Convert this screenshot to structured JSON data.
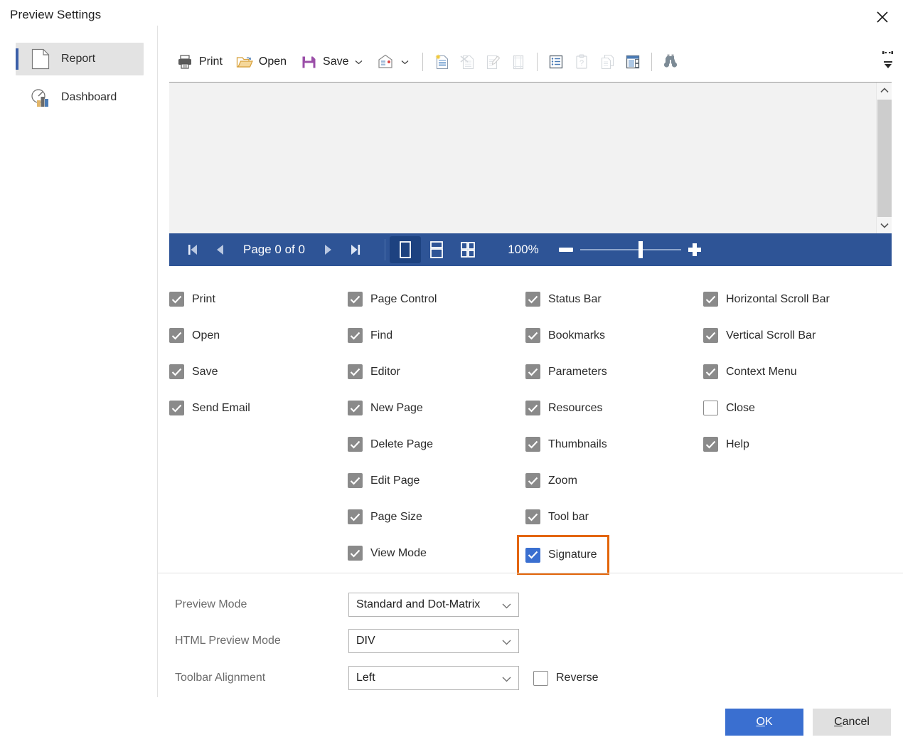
{
  "dialog": {
    "title": "Preview Settings",
    "close_icon": "close-icon"
  },
  "sidebar": {
    "items": [
      {
        "label": "Report",
        "icon": "document-page-icon",
        "selected": true
      },
      {
        "label": "Dashboard",
        "icon": "dashboard-chart-icon",
        "selected": false
      }
    ]
  },
  "toolbar": {
    "buttons": [
      {
        "label": "Print",
        "icon": "printer-icon",
        "caret": false,
        "enabled": true
      },
      {
        "label": "Open",
        "icon": "open-folder-icon",
        "caret": false,
        "enabled": true
      },
      {
        "label": "Save",
        "icon": "floppy-save-icon",
        "caret": true,
        "enabled": true
      },
      {
        "label": "",
        "icon": "send-email-icon",
        "caret": true,
        "enabled": true
      }
    ],
    "icon_buttons": [
      {
        "icon": "new-page-icon",
        "enabled": true
      },
      {
        "icon": "delete-page-icon",
        "enabled": false
      },
      {
        "icon": "edit-page-icon",
        "enabled": false
      },
      {
        "icon": "page-size-icon",
        "enabled": false
      },
      {
        "icon": "bookmarks-icon",
        "enabled": true
      },
      {
        "icon": "parameters-icon",
        "enabled": false
      },
      {
        "icon": "resources-icon",
        "enabled": false
      },
      {
        "icon": "thumbnails-icon",
        "enabled": true
      },
      {
        "icon": "find-binoculars-icon",
        "enabled": true
      }
    ],
    "overflow_icon": "toolbar-overflow-icon"
  },
  "navbar": {
    "first_icon": "first-page-icon",
    "prev_icon": "prev-page-icon",
    "page_label": "Page 0 of 0",
    "next_icon": "next-page-icon",
    "last_icon": "last-page-icon",
    "view_modes": [
      {
        "icon": "single-page-view-icon",
        "active": true
      },
      {
        "icon": "continuous-view-icon",
        "active": false
      },
      {
        "icon": "multi-page-view-icon",
        "active": false
      }
    ],
    "zoom_value": "100%",
    "zoom_minus_icon": "zoom-out-icon",
    "zoom_plus_icon": "zoom-in-icon",
    "zoom_slider_percent": 58,
    "accent_color": "#2e5496"
  },
  "scrollbar": {
    "up_icon": "scroll-up-icon",
    "down_icon": "scroll-down-icon"
  },
  "options": {
    "columns": [
      [
        {
          "label": "Print",
          "checked": true
        },
        {
          "label": "Open",
          "checked": true
        },
        {
          "label": "Save",
          "checked": true
        },
        {
          "label": "Send Email",
          "checked": true
        }
      ],
      [
        {
          "label": "Page Control",
          "checked": true
        },
        {
          "label": "Find",
          "checked": true
        },
        {
          "label": "Editor",
          "checked": true
        },
        {
          "label": "New Page",
          "checked": true
        },
        {
          "label": "Delete Page",
          "checked": true
        },
        {
          "label": "Edit Page",
          "checked": true
        },
        {
          "label": "Page Size",
          "checked": true
        },
        {
          "label": "View Mode",
          "checked": true
        }
      ],
      [
        {
          "label": "Status Bar",
          "checked": true
        },
        {
          "label": "Bookmarks",
          "checked": true
        },
        {
          "label": "Parameters",
          "checked": true
        },
        {
          "label": "Resources",
          "checked": true
        },
        {
          "label": "Thumbnails",
          "checked": true
        },
        {
          "label": "Zoom",
          "checked": true
        },
        {
          "label": "Tool bar",
          "checked": true
        },
        {
          "label": "Signature",
          "checked": true,
          "focused": true,
          "highlighted": true
        }
      ],
      [
        {
          "label": "Horizontal Scroll Bar",
          "checked": true
        },
        {
          "label": "Vertical Scroll Bar",
          "checked": true
        },
        {
          "label": "Context Menu",
          "checked": true
        },
        {
          "label": "Close",
          "checked": false
        },
        {
          "label": "Help",
          "checked": true
        }
      ]
    ],
    "highlight_color": "#e3650a",
    "focus_color": "#3a6fd0"
  },
  "settings": {
    "rows": [
      {
        "label": "Preview Mode",
        "value": "Standard and Dot-Matrix"
      },
      {
        "label": "HTML Preview Mode",
        "value": "DIV"
      },
      {
        "label": "Toolbar Alignment",
        "value": "Left"
      }
    ],
    "reverse": {
      "label": "Reverse",
      "checked": false
    }
  },
  "footer": {
    "ok": {
      "mnemonic": "O",
      "rest": "K"
    },
    "cancel": {
      "mnemonic": "C",
      "rest": "ancel"
    }
  }
}
